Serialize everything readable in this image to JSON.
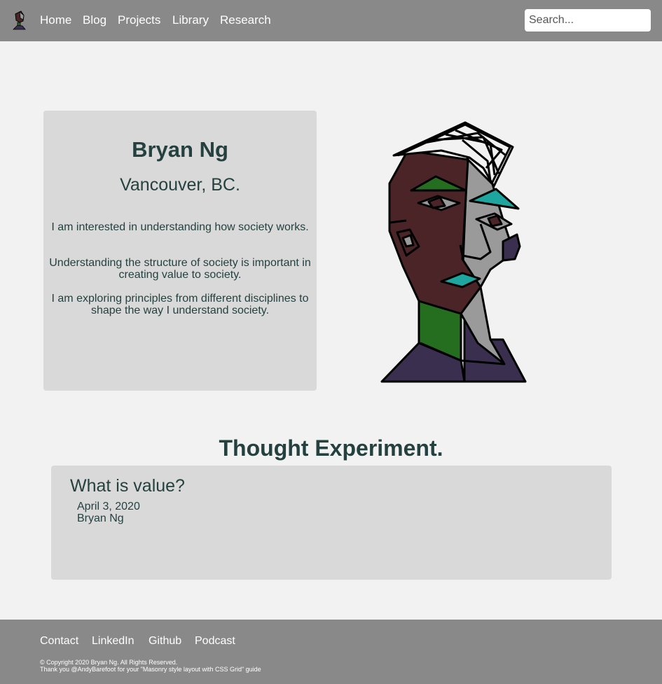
{
  "nav": {
    "logo_icon": "avatar-portrait-icon",
    "links": [
      "Home",
      "Blog",
      "Projects",
      "Library",
      "Research"
    ],
    "search_placeholder": "Search..."
  },
  "profile": {
    "name": "Bryan Ng",
    "location": "Vancouver, BC.",
    "bio": [
      "I am interested in understanding how society works.",
      "Understanding the structure of society is important in creating value to society.",
      "I am exploring principles from different disciplines to shape the way I understand society."
    ],
    "portrait_icon": "cubist-portrait-illustration"
  },
  "thought": {
    "section_title": "Thought Experiment.",
    "post": {
      "title": "What is value?",
      "date": "April 3, 2020",
      "author": "Bryan Ng"
    }
  },
  "footer": {
    "links": [
      "Contact",
      "LinkedIn",
      "Github",
      "Podcast"
    ],
    "copyright": "© Copyright 2020 Bryan Ng. All Rights Reserved.",
    "thanks": "Thank you @AndyBarefoot for your \"Masonry style layout with CSS Grid\" guide"
  },
  "colors": {
    "nav_bg": "#898989",
    "page_bg": "#f2f2f2",
    "card_bg": "#d9d9d9",
    "text": "#24413f"
  }
}
